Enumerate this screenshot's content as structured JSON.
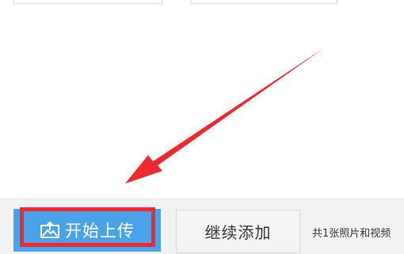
{
  "toolbar": {
    "start_upload_label": "开始上传",
    "continue_add_label": "继续添加",
    "summary_text": "共1张照片和视频"
  },
  "colors": {
    "upload_button": "#4aa3e8",
    "annotation_red": "#ee2a2f",
    "bar_background": "#f2f2f2"
  },
  "icons": {
    "upload": "upload-icon"
  }
}
